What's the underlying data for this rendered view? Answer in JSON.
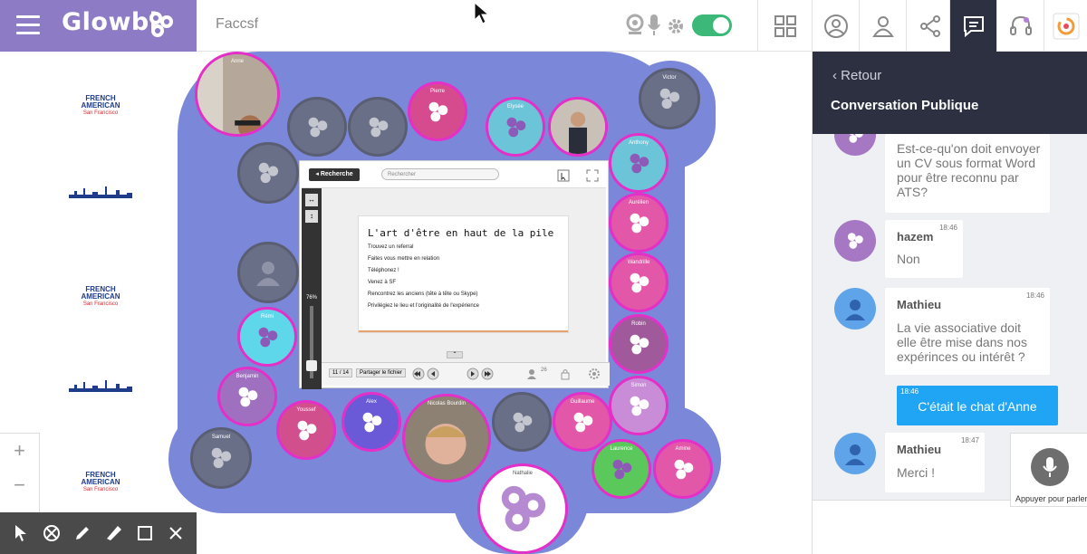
{
  "brand": {
    "name": "Glowbl",
    "accent": "#8e7bc6"
  },
  "room": {
    "name": "Faccsf"
  },
  "topbar": {
    "icons": [
      "webcam-icon",
      "microphone-icon",
      "settings-icon",
      "grid-icon",
      "profile-icon",
      "users-icon",
      "share-icon",
      "chat-icon",
      "headset-icon",
      "app-icon"
    ],
    "toggle_on": true,
    "toggle_color": "#3cb878"
  },
  "sponsors": [
    {
      "line1": "FRENCH AMERICAN",
      "line2": "San Francisco"
    },
    {
      "line1": "FRENCH AMERICAN",
      "line2": "San Francisco"
    },
    {
      "line1": "FRENCH AMERICAN",
      "line2": "San Francisco"
    }
  ],
  "participants": [
    "Anne",
    "Pierre",
    "Elysée",
    "Victor",
    "Anthony",
    "Aurélien",
    "Wandrille",
    "Robin",
    "Simon",
    "Guillaume",
    "Laurence",
    "Amine",
    "Nathalie",
    "Nicolas Bourdin",
    "Alex",
    "Youssef",
    "Benjamin",
    "Rémi",
    "Mathieu",
    "Samuel"
  ],
  "presentation": {
    "back_label": "◂ Recherche",
    "search_placeholder": "Rechercher",
    "zoom": "76%",
    "page": "11 / 14",
    "share_label": "Partager le fichier",
    "viewers": "26",
    "slide": {
      "title": "L'art d'être en haut de la pile",
      "bullets": [
        "Trouvez un referral",
        "Faites vous mettre en relation",
        "Téléphonez !",
        "Venez à SF",
        "Rencontrez les anciens (tête à tête ou Skype)",
        "Privilégiez le lieu et l'originalité de l'expérience"
      ]
    }
  },
  "zoom_controls": {
    "plus": "+",
    "minus": "−"
  },
  "tools": [
    "cursor-tool-icon",
    "eraser-tool-icon",
    "pencil-tool-icon",
    "marker-tool-icon",
    "rectangle-tool-icon",
    "close-tool-icon"
  ],
  "chat": {
    "back_label": "Retour",
    "title": "Conversation Publique",
    "messages": [
      {
        "author": "",
        "time": "",
        "text": "Est-ce-qu'on doit envoyer un CV sous format Word pour être reconnu par ATS?"
      },
      {
        "author": "hazem",
        "time": "18:46",
        "text": "Non"
      },
      {
        "author": "Mathieu",
        "time": "18:46",
        "text": "La vie associative doit elle être mise dans nos expérinces ou intérêt ?"
      },
      {
        "author": "",
        "time": "18:46",
        "text": "C'était le chat d'Anne"
      },
      {
        "author": "Mathieu",
        "time": "18:47",
        "text": "Merci !"
      }
    ],
    "push_to_talk": "Appuyer pour parler",
    "own_color": "#20a5f5"
  }
}
